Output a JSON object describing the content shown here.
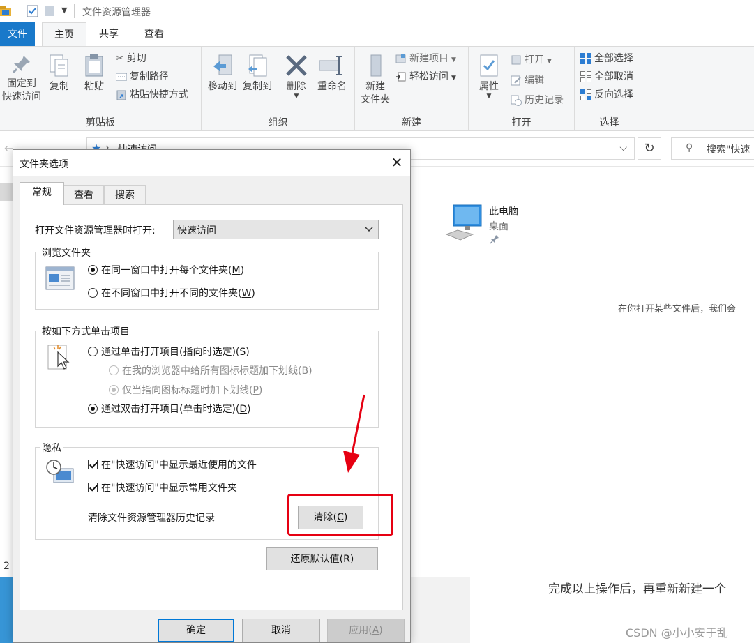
{
  "explorer": {
    "window_title": "文件资源管理器",
    "ribbon_tabs": [
      {
        "label": "文件"
      },
      {
        "label": "主页"
      },
      {
        "label": "共享"
      },
      {
        "label": "查看"
      }
    ],
    "clipboard": {
      "group_label": "剪贴板",
      "pin_line1": "固定到",
      "pin_line2": "快速访问",
      "copy": "复制",
      "paste": "粘贴",
      "cut": "剪切",
      "copy_path": "复制路径",
      "paste_shortcut": "粘贴快捷方式"
    },
    "organize": {
      "group_label": "组织",
      "move_to": "移动到",
      "copy_to": "复制到",
      "delete": "删除",
      "rename": "重命名"
    },
    "new": {
      "group_label": "新建",
      "new_folder_line1": "新建",
      "new_folder_line2": "文件夹",
      "new_item": "新建项目",
      "easy_access": "轻松访问"
    },
    "open": {
      "group_label": "打开",
      "properties": "属性",
      "open": "打开",
      "edit": "编辑",
      "history": "历史记录"
    },
    "select": {
      "group_label": "选择",
      "select_all": "全部选择",
      "select_none": "全部取消",
      "invert": "反向选择"
    },
    "address": {
      "path": "快速访问",
      "search_placeholder": "搜索\"快速"
    },
    "content": {
      "this_pc_name": "此电脑",
      "this_pc_location": "桌面",
      "recent_hint": "在你打开某些文件后，我们会"
    },
    "left_number": "2"
  },
  "article": {
    "text": "完成以上操作后，再重新新建一个",
    "watermark": "CSDN @小小安于乱"
  },
  "dialog": {
    "title": "文件夹选项",
    "tabs": [
      {
        "label": "常规"
      },
      {
        "label": "查看"
      },
      {
        "label": "搜索"
      }
    ],
    "open_explorer_label": "打开文件资源管理器时打开:",
    "open_explorer_value": "快速访问",
    "browse": {
      "legend": "浏览文件夹",
      "same_window_text": "在同一窗口中打开每个文件夹(",
      "same_window_key": "M",
      "new_window_text": "在不同窗口中打开不同的文件夹(",
      "new_window_key": "W",
      "selected": "same_window"
    },
    "click": {
      "legend": "按如下方式单击项目",
      "single_text": "通过单击打开项目(指向时选定)(",
      "single_key": "S",
      "underline_all_text": "在我的浏览器中给所有图标标题加下划线(",
      "underline_all_key": "B",
      "underline_hover_text": "仅当指向图标标题时加下划线(",
      "underline_hover_key": "P",
      "double_text": "通过双击打开项目(单击时选定)(",
      "double_key": "D",
      "selected": "double"
    },
    "privacy": {
      "legend": "隐私",
      "show_recent_files": "在\"快速访问\"中显示最近使用的文件",
      "show_frequent_folders": "在\"快速访问\"中显示常用文件夹",
      "recent_checked": true,
      "frequent_checked": true,
      "clear_history_label": "清除文件资源管理器历史记录",
      "clear_button_text": "清除(",
      "clear_button_key": "C"
    },
    "restore_defaults_text": "还原默认值(",
    "restore_defaults_key": "R",
    "ok": "确定",
    "cancel": "取消",
    "apply_text": "应用(",
    "apply_key": "A",
    "close_x": "✕"
  },
  "annotation_color": "#e60012",
  "colors": {
    "file_tab": "#1979ca",
    "primary_focus": "#0078d7"
  }
}
